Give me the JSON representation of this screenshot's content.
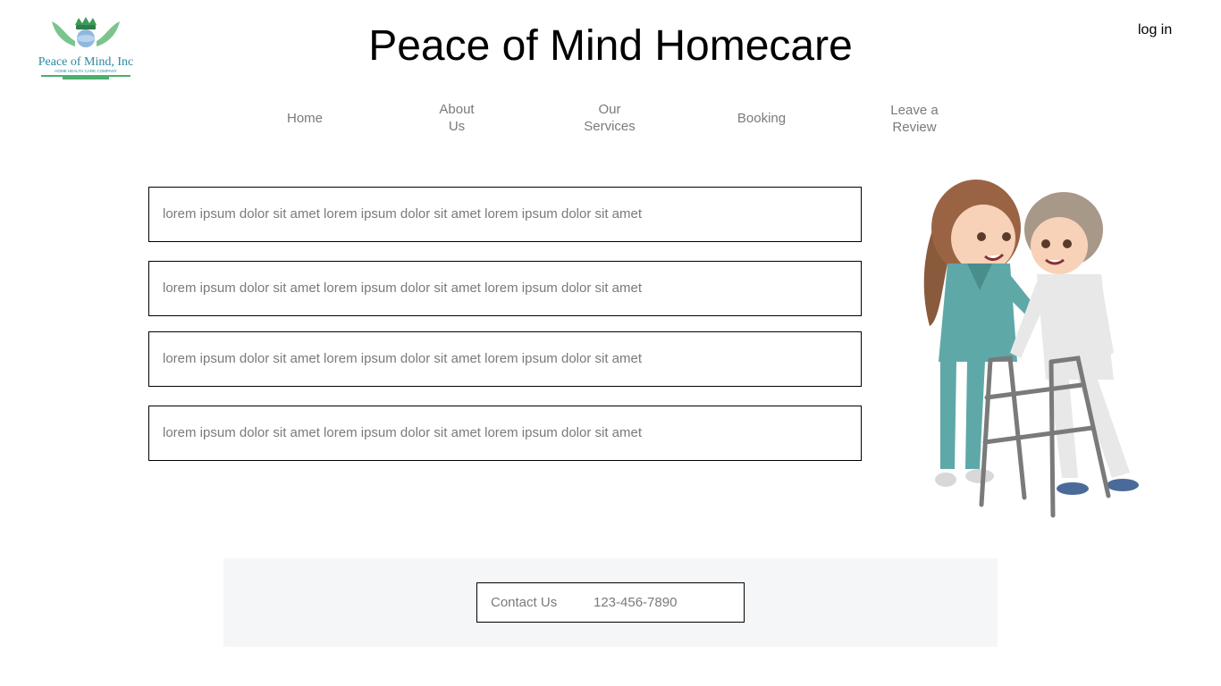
{
  "header": {
    "logo_text": "Peace of Mind, Inc",
    "logo_subtext": "HOME HEALTH CARE COMPANY",
    "title": "Peace of Mind Homecare",
    "login_label": "log in"
  },
  "nav": {
    "items": [
      {
        "label": "Home"
      },
      {
        "label": "About\nUs"
      },
      {
        "label": "Our\nServices"
      },
      {
        "label": "Booking"
      },
      {
        "label": "Leave a\nReview"
      }
    ]
  },
  "content": {
    "boxes": [
      {
        "text": "lorem ipsum dolor sit amet lorem ipsum dolor sit amet lorem ipsum dolor sit amet"
      },
      {
        "text": "lorem ipsum dolor sit amet lorem ipsum dolor sit amet lorem ipsum dolor sit amet"
      },
      {
        "text": "lorem ipsum dolor sit amet lorem ipsum dolor sit amet lorem ipsum dolor sit amet"
      },
      {
        "text": "lorem ipsum dolor sit amet lorem ipsum dolor sit amet lorem ipsum dolor sit amet"
      }
    ]
  },
  "footer": {
    "contact_label": "Contact Us",
    "phone": "123-456-7890"
  },
  "colors": {
    "nav_text": "#7a7a7a",
    "logo_green": "#4caf6e",
    "logo_teal": "#2a8aa0",
    "scrubs": "#5fa8a8",
    "footer_bg": "#f5f6f8"
  }
}
